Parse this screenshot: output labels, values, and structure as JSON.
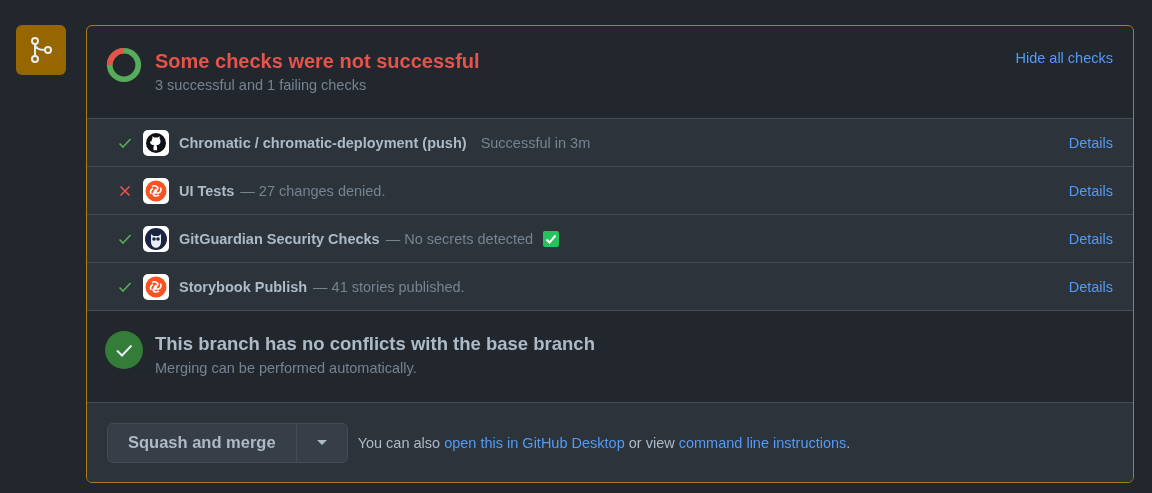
{
  "header": {
    "title": "Some checks were not successful",
    "subtitle": "3 successful and 1 failing checks",
    "toggle_link": "Hide all checks"
  },
  "checks": [
    {
      "failed": false,
      "kind": "github",
      "name": "Chromatic / chromatic-deployment (push)",
      "description": "Successful in 3m",
      "verified": false,
      "details": "Details"
    },
    {
      "failed": true,
      "kind": "chromatic",
      "name": "UI Tests",
      "description": "— 27 changes denied.",
      "verified": false,
      "details": "Details"
    },
    {
      "failed": false,
      "kind": "owl",
      "name": "GitGuardian Security Checks",
      "description": "— No secrets detected",
      "verified": true,
      "details": "Details"
    },
    {
      "failed": false,
      "kind": "chromatic",
      "name": "Storybook Publish",
      "description": "— 41 stories published.",
      "verified": false,
      "details": "Details"
    }
  ],
  "merge_status": {
    "title": "This branch has no conflicts with the base branch",
    "subtitle": "Merging can be performed automatically."
  },
  "footer": {
    "button": "Squash and merge",
    "text_before": "You can also",
    "link_desktop": "open this in GitHub Desktop",
    "text_middle": "or view",
    "link_cli": "command line instructions",
    "text_after": "."
  }
}
